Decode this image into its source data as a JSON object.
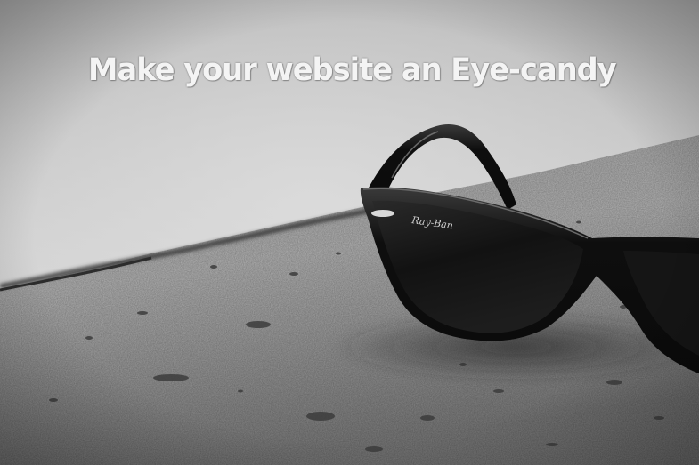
{
  "headline": "Make your website an Eye-candy",
  "photo": {
    "subject": "sunglasses-on-concrete-ledge",
    "brand_logo": "Ray-Ban",
    "tone": "black-and-white",
    "colors": {
      "sky_top": "#bdbdbd",
      "sky_bottom": "#d6d6d6",
      "concrete_light": "#b2b2b2",
      "concrete_dark": "#4a4a4a",
      "lens": "#141414",
      "headline_text": "#f4f4f4"
    }
  }
}
